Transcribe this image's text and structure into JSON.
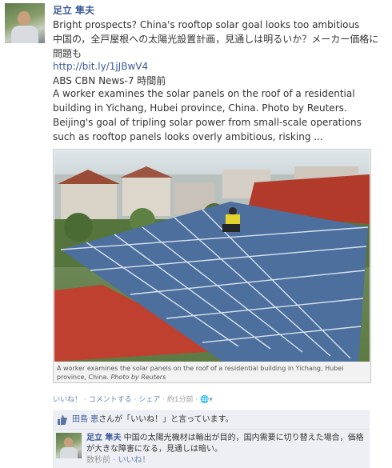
{
  "post": {
    "author": "足立 隼夫",
    "title_en": "Bright prospects? China's rooftop solar goal looks too ambitious",
    "title_ja": "中国の，全戸屋根への太陽光設置計画，見通しは明るいか？メーカー価格に問題も",
    "link": "http://bit.ly/1jJBwV4",
    "source": "ABS CBN News-7 時間前",
    "description": "A worker examines the solar panels on the roof of a residential building in Yichang, Hubei province, China. Photo by Reuters. Beijing's goal of tripling solar power from small-scale operations such as rooftop panels looks overly ambitious, risking ...",
    "photo_caption": "A worker examines the solar panels on the roof of a residential building in Yichang, Hubei province, China.",
    "photo_credit": "Photo by Reuters",
    "photo_icon": "solar-roof-photo"
  },
  "actions": {
    "like": "いいね！",
    "comment": "コメントする",
    "share": "シェア",
    "time": "約1分前",
    "audience_icon": "globe-icon"
  },
  "likes": {
    "liker": "田島 恵",
    "text": "さんが「いいね！」と言っています。"
  },
  "comment": {
    "author": "足立 隼夫",
    "text": "中国の太陽光機材は輸出が目的，国内需要に切り替えた場合，価格が大きな障害になる，見通しは暗い。",
    "time": "数秒前",
    "like": "いいね！"
  }
}
